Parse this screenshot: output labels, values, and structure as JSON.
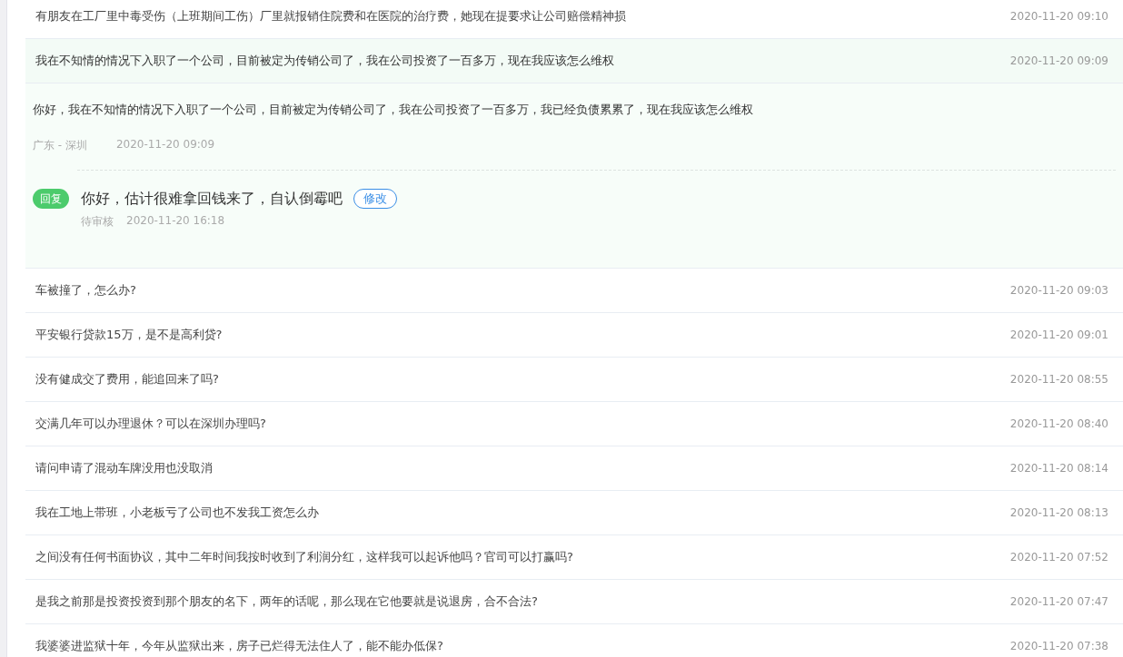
{
  "questions": [
    {
      "text": "有朋友在工厂里中毒受伤（上班期间工伤）厂里就报销住院费和在医院的治疗费，她现在提要求让公司赔偿精神损",
      "time": "2020-11-20 09:10",
      "expanded": false
    },
    {
      "text": "我在不知情的情况下入职了一个公司，目前被定为传销公司了，我在公司投资了一百多万，现在我应该怎么维权",
      "time": "2020-11-20 09:09",
      "expanded": true,
      "detail": {
        "question": "你好，我在不知情的情况下入职了一个公司，目前被定为传销公司了，我在公司投资了一百多万，我已经负债累累了，现在我应该怎么维权",
        "location": "广东 - 深圳",
        "time": "2020-11-20 09:09",
        "reply": {
          "badge": "回复",
          "text": "你好，估计很难拿回钱来了，自认倒霉吧",
          "edit": "修改",
          "status": "待审核",
          "time": "2020-11-20 16:18"
        }
      }
    },
    {
      "text": "车被撞了，怎么办?",
      "time": "2020-11-20 09:03",
      "expanded": false
    },
    {
      "text": "平安银行贷款15万，是不是高利贷?",
      "time": "2020-11-20 09:01",
      "expanded": false
    },
    {
      "text": "没有健成交了费用，能追回来了吗?",
      "time": "2020-11-20 08:55",
      "expanded": false
    },
    {
      "text": "交满几年可以办理退休？可以在深圳办理吗?",
      "time": "2020-11-20 08:40",
      "expanded": false
    },
    {
      "text": "请问申请了混动车牌没用也没取消",
      "time": "2020-11-20 08:14",
      "expanded": false
    },
    {
      "text": "我在工地上带班，小老板亏了公司也不发我工资怎么办",
      "time": "2020-11-20 08:13",
      "expanded": false
    },
    {
      "text": "之间没有任何书面协议，其中二年时间我按时收到了利润分红，这样我可以起诉他吗？官司可以打赢吗?",
      "time": "2020-11-20 07:52",
      "expanded": false
    },
    {
      "text": "是我之前那是投资投资到那个朋友的名下，两年的话呢，那么现在它他要就是说退房，合不合法?",
      "time": "2020-11-20 07:47",
      "expanded": false
    },
    {
      "text": "我婆婆进监狱十年，今年从监狱出来，房子已烂得无法住人了，能不能办低保?",
      "time": "2020-11-20 07:38",
      "expanded": false
    }
  ]
}
